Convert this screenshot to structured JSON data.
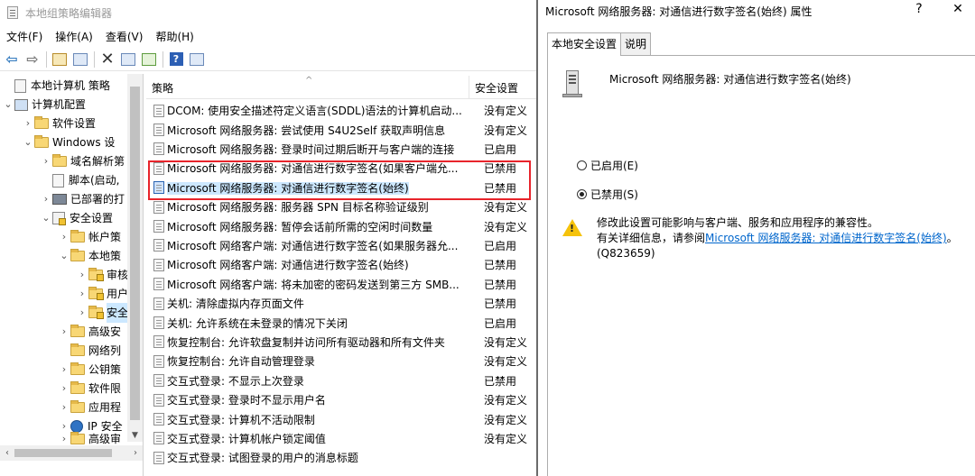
{
  "editor": {
    "title": "本地组策略编辑器",
    "menu": [
      "文件(F)",
      "操作(A)",
      "查看(V)",
      "帮助(H)"
    ],
    "toolbar_icons": [
      "back-arrow-icon",
      "forward-arrow-icon",
      "up-folder-icon",
      "show-hide-tree-icon",
      "delete-icon",
      "properties-icon",
      "export-list-icon",
      "help-icon",
      "show-hide-action-pane-icon"
    ],
    "tree": [
      {
        "label": "本地计算机 策略",
        "icon": "policy-icon"
      },
      {
        "label": "计算机配置",
        "icon": "computer-icon"
      },
      {
        "label": "软件设置",
        "icon": "folder-icon"
      },
      {
        "label": "Windows 设",
        "icon": "folder-icon"
      },
      {
        "label": "域名解析第",
        "icon": "folder-icon"
      },
      {
        "label": "脚本(启动,",
        "icon": "script-icon"
      },
      {
        "label": "已部署的打",
        "icon": "printer-icon"
      },
      {
        "label": "安全设置",
        "icon": "security-icon"
      },
      {
        "label": "帐户策",
        "icon": "folder-icon"
      },
      {
        "label": "本地策",
        "icon": "folder-icon"
      },
      {
        "label": "审核",
        "icon": "folder-icon"
      },
      {
        "label": "用户",
        "icon": "folder-icon"
      },
      {
        "label": "安全",
        "icon": "folder-icon"
      },
      {
        "label": "高级安",
        "icon": "folder-icon"
      },
      {
        "label": "网络列",
        "icon": "folder-icon"
      },
      {
        "label": "公钥策",
        "icon": "folder-icon"
      },
      {
        "label": "软件限",
        "icon": "folder-icon"
      },
      {
        "label": "应用程",
        "icon": "folder-icon"
      },
      {
        "label": "IP 安全",
        "icon": "ip-security-icon"
      },
      {
        "label": "高级审",
        "icon": "folder-icon"
      }
    ],
    "list": {
      "columns": [
        "策略",
        "安全设置"
      ],
      "rows": [
        {
          "name": "DCOM: 使用安全描述符定义语言(SDDL)语法的计算机启动...",
          "value": "没有定义"
        },
        {
          "name": "Microsoft 网络服务器: 尝试使用 S4U2Self 获取声明信息",
          "value": "没有定义"
        },
        {
          "name": "Microsoft 网络服务器: 登录时间过期后断开与客户端的连接",
          "value": "已启用"
        },
        {
          "name": "Microsoft 网络服务器: 对通信进行数字签名(如果客户端允...",
          "value": "已禁用"
        },
        {
          "name": "Microsoft 网络服务器: 对通信进行数字签名(始终)",
          "value": "已禁用"
        },
        {
          "name": "Microsoft 网络服务器: 服务器 SPN 目标名称验证级别",
          "value": "没有定义"
        },
        {
          "name": "Microsoft 网络服务器: 暂停会话前所需的空闲时间数量",
          "value": "没有定义"
        },
        {
          "name": "Microsoft 网络客户端: 对通信进行数字签名(如果服务器允...",
          "value": "已启用"
        },
        {
          "name": "Microsoft 网络客户端: 对通信进行数字签名(始终)",
          "value": "已禁用"
        },
        {
          "name": "Microsoft 网络客户端: 将未加密的密码发送到第三方 SMB...",
          "value": "已禁用"
        },
        {
          "name": "关机: 清除虚拟内存页面文件",
          "value": "已禁用"
        },
        {
          "name": "关机: 允许系统在未登录的情况下关闭",
          "value": "已启用"
        },
        {
          "name": "恢复控制台: 允许软盘复制并访问所有驱动器和所有文件夹",
          "value": "没有定义"
        },
        {
          "name": "恢复控制台: 允许自动管理登录",
          "value": "没有定义"
        },
        {
          "name": "交互式登录: 不显示上次登录",
          "value": "已禁用"
        },
        {
          "name": "交互式登录: 登录时不显示用户名",
          "value": "没有定义"
        },
        {
          "name": "交互式登录: 计算机不活动限制",
          "value": "没有定义"
        },
        {
          "name": "交互式登录: 计算机帐户锁定阈值",
          "value": "没有定义"
        },
        {
          "name": "交互式登录: 试图登录的用户的消息标题",
          "value": ""
        }
      ]
    }
  },
  "dialog": {
    "title": "Microsoft 网络服务器: 对通信进行数字签名(始终) 属性",
    "help": "?",
    "close": "✕",
    "tabs": [
      "本地安全设置",
      "说明"
    ],
    "policy_name": "Microsoft 网络服务器: 对通信进行数字签名(始终)",
    "options": [
      {
        "label": "已启用(E)",
        "checked": false
      },
      {
        "label": "已禁用(S)",
        "checked": true
      }
    ],
    "warning": {
      "line1": "修改此设置可能影响与客户端、服务和应用程序的兼容性。",
      "line2_prefix": "有关详细信息，请参阅",
      "link": "Microsoft 网络服务器: 对通信进行数字签名(始终)",
      "suffix": "。(Q823659)"
    }
  },
  "colors": {
    "highlight_box": "#e8242b",
    "selection": "#cce8ff",
    "link": "#0066cc"
  }
}
